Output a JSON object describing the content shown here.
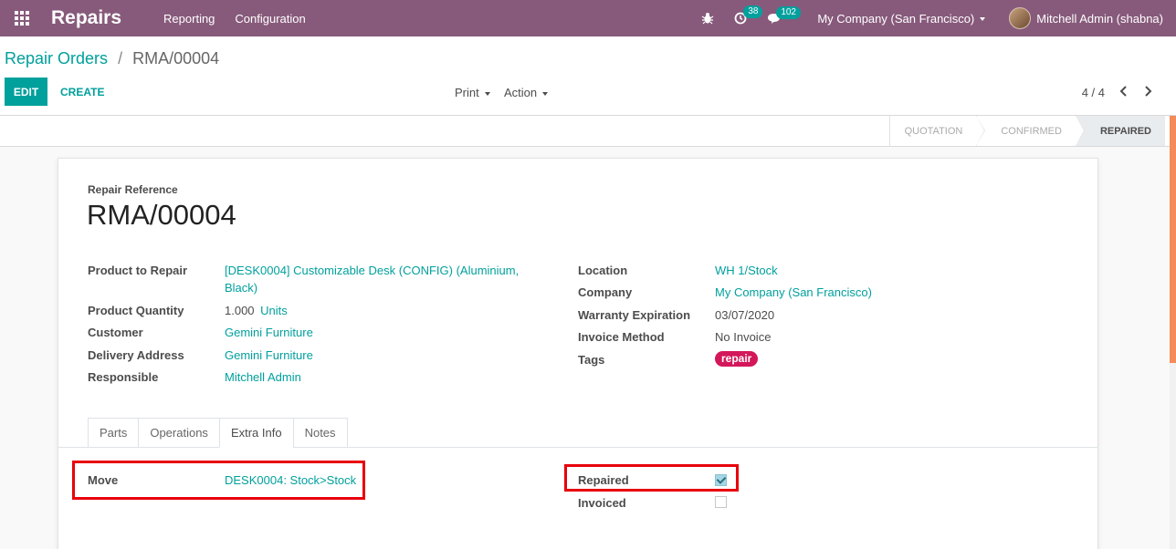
{
  "navbar": {
    "app_title": "Repairs",
    "menus": [
      "Reporting",
      "Configuration"
    ],
    "activity_badge": "38",
    "messages_badge": "102",
    "company": "My Company (San Francisco)",
    "user": "Mitchell Admin (shabna)",
    "color": "#875a7b"
  },
  "control_panel": {
    "breadcrumb_parent": "Repair Orders",
    "breadcrumb_sep": "/",
    "breadcrumb_current": "RMA/00004",
    "edit_label": "EDIT",
    "create_label": "CREATE",
    "print_label": "Print",
    "action_label": "Action",
    "pager": "4 / 4"
  },
  "statusbar": {
    "stages": [
      "QUOTATION",
      "CONFIRMED",
      "REPAIRED"
    ],
    "active_stage": "REPAIRED"
  },
  "form": {
    "ref_label": "Repair Reference",
    "ref_value": "RMA/00004",
    "left": {
      "product_label": "Product to Repair",
      "product_value_1": "[DESK0004] Customizable Desk (CONFIG) (Aluminium,",
      "product_value_2": "Black)",
      "qty_label": "Product Quantity",
      "qty_value": "1.000",
      "qty_unit": "Units",
      "customer_label": "Customer",
      "customer_value": "Gemini Furniture",
      "delivery_label": "Delivery Address",
      "delivery_value": "Gemini Furniture",
      "responsible_label": "Responsible",
      "responsible_value": "Mitchell Admin"
    },
    "right": {
      "location_label": "Location",
      "location_value": "WH 1/Stock",
      "company_label": "Company",
      "company_value": "My Company (San Francisco)",
      "warranty_label": "Warranty Expiration",
      "warranty_value": "03/07/2020",
      "invoice_method_label": "Invoice Method",
      "invoice_method_value": "No Invoice",
      "tags_label": "Tags",
      "tag_value": "repair"
    },
    "tabs": [
      "Parts",
      "Operations",
      "Extra Info",
      "Notes"
    ],
    "active_tab": "Extra Info",
    "extra_info": {
      "move_label": "Move",
      "move_value": "DESK0004: Stock>Stock",
      "repaired_label": "Repaired",
      "repaired_checked": true,
      "invoiced_label": "Invoiced",
      "invoiced_checked": false
    }
  },
  "colors": {
    "accent": "#00a09d",
    "highlight": "#e8000b",
    "tag": "#d3175a"
  }
}
